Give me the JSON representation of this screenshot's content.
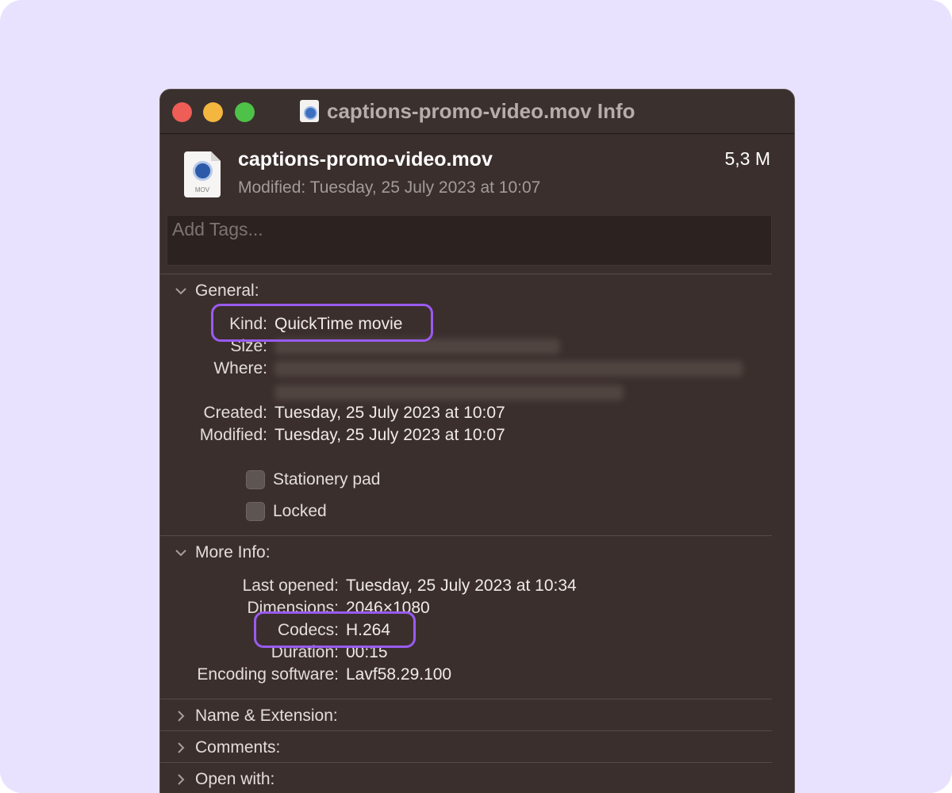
{
  "window": {
    "title": "captions-promo-video.mov Info"
  },
  "file": {
    "name": "captions-promo-video.mov",
    "modified_line": "Modified: Tuesday, 25 July 2023 at 10:07",
    "size": "5,3 M",
    "icon_ext": "MOV"
  },
  "tags": {
    "placeholder": "Add Tags..."
  },
  "general": {
    "header": "General:",
    "kind_label": "Kind:",
    "kind_value": "QuickTime movie",
    "size_label": "Size:",
    "where_label": "Where:",
    "created_label": "Created:",
    "created_value": "Tuesday, 25 July 2023 at 10:07",
    "modified_label": "Modified:",
    "modified_value": "Tuesday, 25 July 2023 at 10:07",
    "stationery_label": "Stationery pad",
    "locked_label": "Locked"
  },
  "more_info": {
    "header": "More Info:",
    "last_opened_label": "Last opened:",
    "last_opened_value": "Tuesday, 25 July 2023 at 10:34",
    "dimensions_label": "Dimensions:",
    "dimensions_value": "2046×1080",
    "codecs_label": "Codecs:",
    "codecs_value": "H.264",
    "duration_label": "Duration:",
    "duration_value": "00:15",
    "encoding_label": "Encoding software:",
    "encoding_value": "Lavf58.29.100"
  },
  "collapsed_sections": {
    "name_ext": "Name & Extension:",
    "comments": "Comments:",
    "open_with": "Open with:"
  },
  "colors": {
    "backdrop": "#e8e2fe",
    "window": "#3b2f2d",
    "highlight": "#9a5bf0"
  }
}
